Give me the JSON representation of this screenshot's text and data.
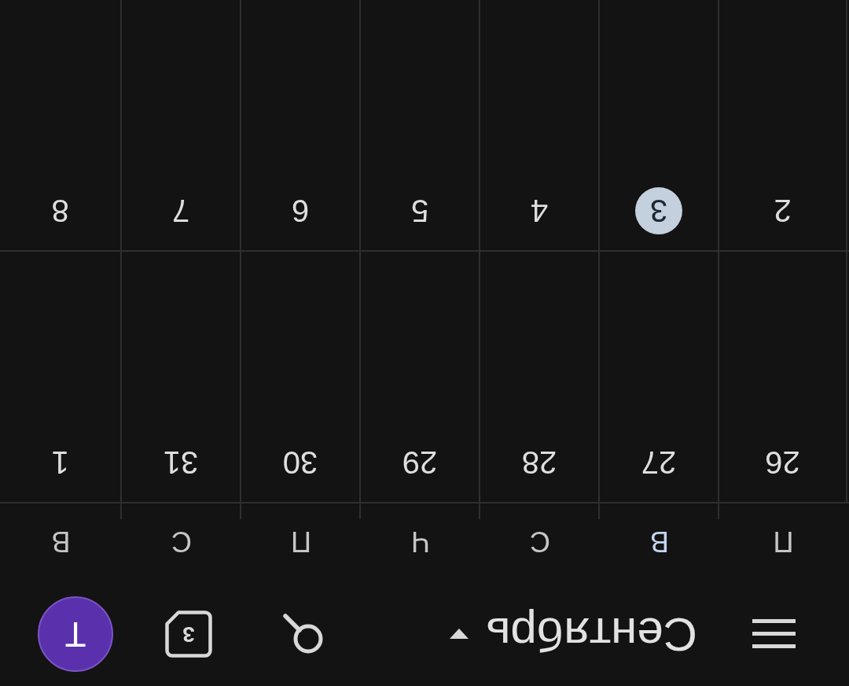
{
  "app_bar": {
    "month": "Сентябрь",
    "today_icon_day": "3",
    "avatar_initial": "T"
  },
  "weekdays": [
    {
      "label": "П",
      "today": false
    },
    {
      "label": "В",
      "today": true
    },
    {
      "label": "С",
      "today": false
    },
    {
      "label": "Ч",
      "today": false
    },
    {
      "label": "П",
      "today": false
    },
    {
      "label": "С",
      "today": false
    },
    {
      "label": "В",
      "today": false
    }
  ],
  "weeks": [
    {
      "days": [
        {
          "label": "26",
          "today": false
        },
        {
          "label": "27",
          "today": false
        },
        {
          "label": "28",
          "today": false
        },
        {
          "label": "29",
          "today": false
        },
        {
          "label": "30",
          "today": false
        },
        {
          "label": "31",
          "today": false
        },
        {
          "label": "1",
          "today": false
        }
      ]
    },
    {
      "days": [
        {
          "label": "2",
          "today": false
        },
        {
          "label": "3",
          "today": true
        },
        {
          "label": "4",
          "today": false
        },
        {
          "label": "5",
          "today": false
        },
        {
          "label": "6",
          "today": false
        },
        {
          "label": "7",
          "today": false
        },
        {
          "label": "8",
          "today": false
        }
      ]
    }
  ]
}
